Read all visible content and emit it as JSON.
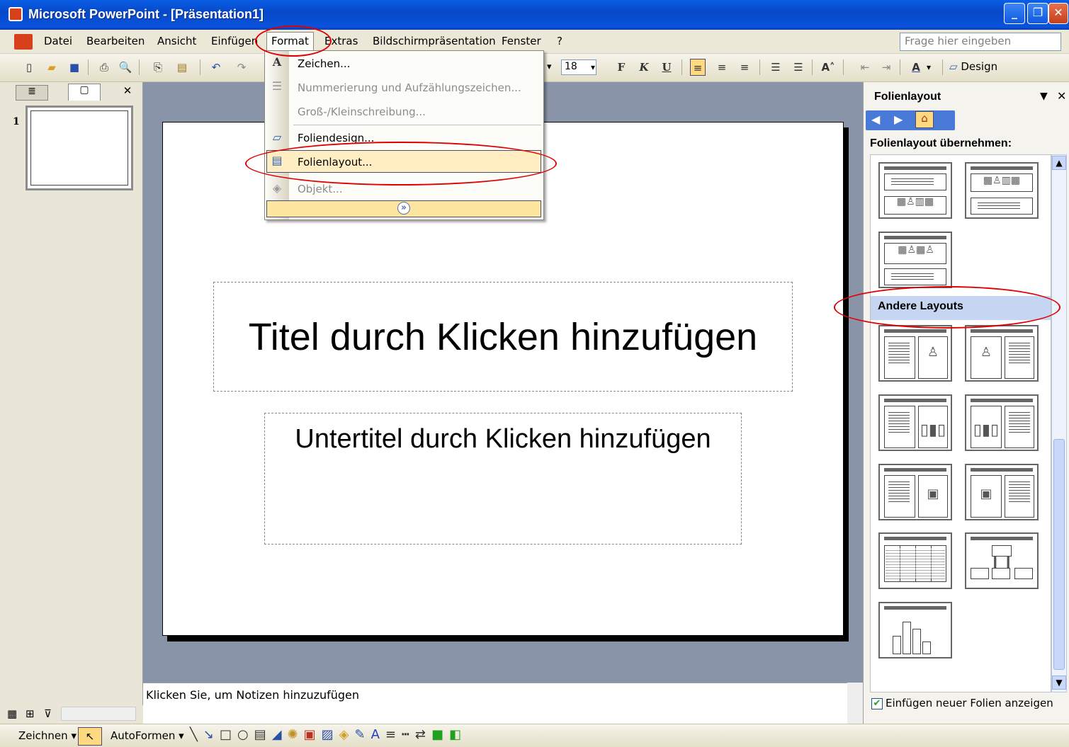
{
  "window": {
    "title": "Microsoft PowerPoint - [Präsentation1]"
  },
  "menubar": {
    "items": [
      "Datei",
      "Bearbeiten",
      "Ansicht",
      "Einfügen",
      "Format",
      "Extras",
      "Bildschirmpräsentation",
      "Fenster",
      "?"
    ],
    "help_placeholder": "Frage hier eingeben"
  },
  "toolbar": {
    "font_size": "18",
    "bold": "F",
    "italic": "K",
    "underline": "U",
    "design_label": "Design"
  },
  "format_menu": {
    "items": [
      {
        "label": "Zeichen...",
        "enabled": true,
        "icon": "font-A-icon"
      },
      {
        "label": "Nummerierung und Aufzählungszeichen...",
        "enabled": false,
        "icon": "bullet-list-icon"
      },
      {
        "label": "Groß-/Kleinschreibung...",
        "enabled": false,
        "icon": ""
      },
      {
        "label": "Foliendesign...",
        "enabled": true,
        "icon": "slide-design-icon"
      },
      {
        "label": "Folienlayout...",
        "enabled": true,
        "highlighted": true,
        "icon": "slide-layout-icon"
      },
      {
        "label": "Objekt...",
        "enabled": false,
        "icon": "object-icon"
      }
    ],
    "expand_glyph": "»"
  },
  "outline": {
    "slide_number": "1"
  },
  "slide": {
    "title_placeholder": "Titel durch Klicken hinzufügen",
    "subtitle_placeholder": "Untertitel durch Klicken hinzufügen"
  },
  "notes": {
    "placeholder": "Klicken Sie, um Notizen hinzuzufügen"
  },
  "taskpane": {
    "title": "Folienlayout",
    "apply_label": "Folienlayout übernehmen:",
    "section_other": "Andere Layouts",
    "show_on_insert_label": "Einfügen neuer Folien anzeigen",
    "show_on_insert_checked": true
  },
  "drawing": {
    "draw_label": "Zeichnen",
    "autoshapes_label": "AutoFormen"
  },
  "colors": {
    "titlebar": "#0a52dc",
    "menu_highlight": "#ffeec2",
    "annotation_red": "#e00000",
    "slide_bg": "#8a94a8"
  }
}
